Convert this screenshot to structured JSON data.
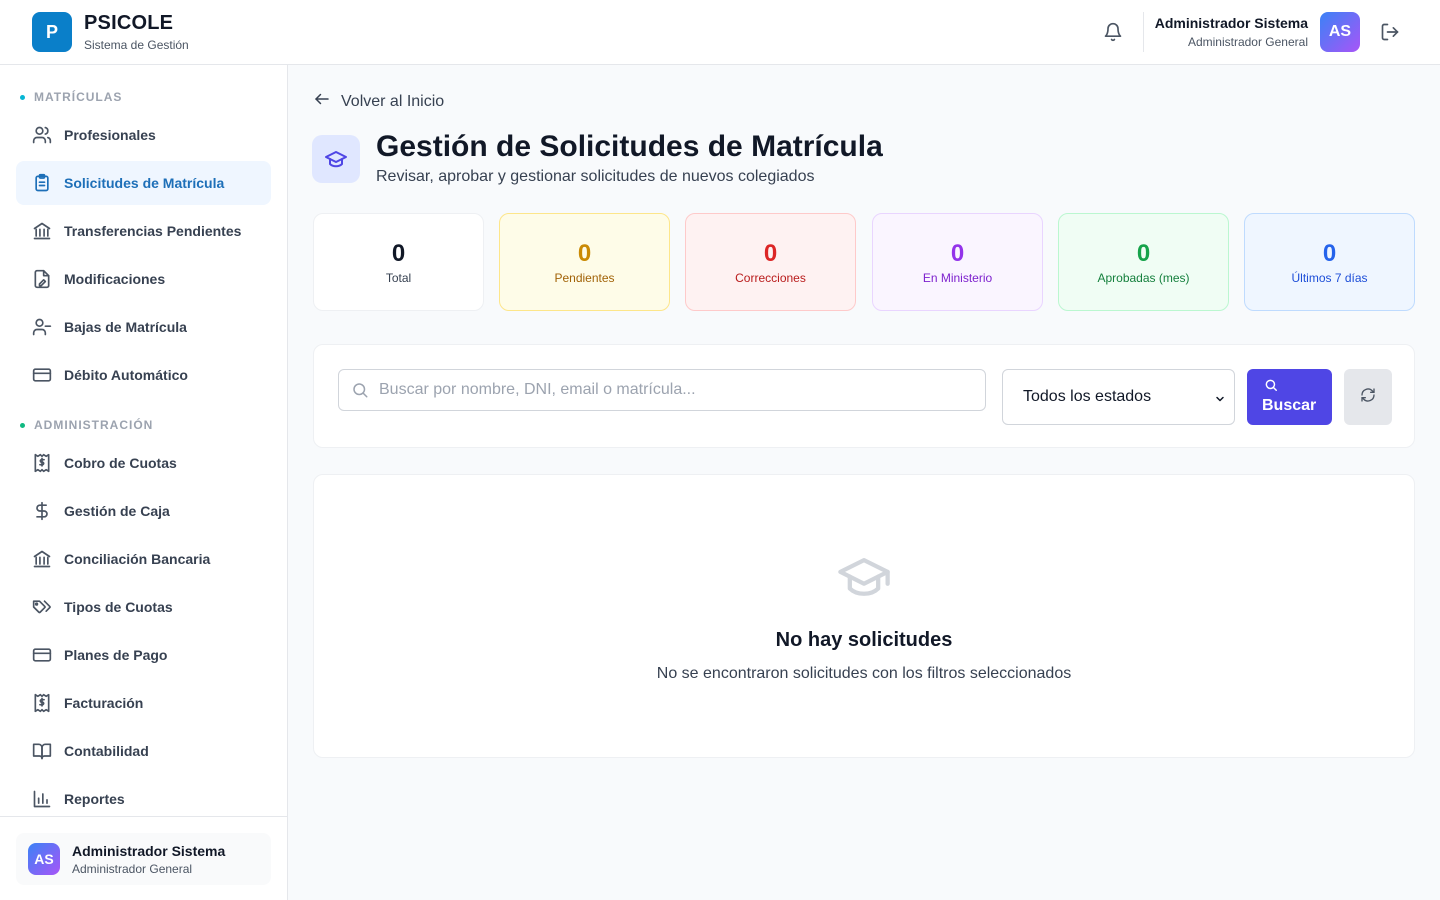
{
  "header": {
    "logo_letter": "P",
    "brand": "PSICOLE",
    "brand_sub": "Sistema de Gestión",
    "user_name": "Administrador Sistema",
    "user_role": "Administrador General",
    "avatar_initials": "AS",
    "icons": [
      "bell-icon",
      "logout-icon"
    ]
  },
  "sidebar": {
    "sections": [
      {
        "label": "MATRÍCULAS",
        "dot_color": "#06b6d4",
        "items": [
          {
            "label": "Profesionales",
            "icon": "users-icon"
          },
          {
            "label": "Solicitudes de Matrícula",
            "icon": "clipboard-list-icon",
            "active": true
          },
          {
            "label": "Transferencias Pendientes",
            "icon": "bank-icon"
          },
          {
            "label": "Modificaciones",
            "icon": "file-edit-icon"
          },
          {
            "label": "Bajas de Matrícula",
            "icon": "user-minus-icon"
          },
          {
            "label": "Débito Automático",
            "icon": "credit-card-icon"
          }
        ]
      },
      {
        "label": "ADMINISTRACIÓN",
        "dot_color": "#10b981",
        "items": [
          {
            "label": "Cobro de Cuotas",
            "icon": "receipt-dollar-icon"
          },
          {
            "label": "Gestión de Caja",
            "icon": "dollar-icon"
          },
          {
            "label": "Conciliación Bancaria",
            "icon": "bank-icon"
          },
          {
            "label": "Tipos de Cuotas",
            "icon": "tags-icon"
          },
          {
            "label": "Planes de Pago",
            "icon": "credit-card-icon"
          },
          {
            "label": "Facturación",
            "icon": "receipt-dollar-icon"
          },
          {
            "label": "Contabilidad",
            "icon": "book-open-icon"
          },
          {
            "label": "Reportes",
            "icon": "bar-chart-icon"
          }
        ]
      }
    ],
    "footer": {
      "avatar_initials": "AS",
      "name": "Administrador Sistema",
      "role": "Administrador General"
    }
  },
  "main": {
    "back_label": "Volver al Inicio",
    "title": "Gestión de Solicitudes de Matrícula",
    "subtitle": "Revisar, aprobar y gestionar solicitudes de nuevos colegiados",
    "stats": [
      {
        "value": "0",
        "label": "Total",
        "bg": "#ffffff",
        "border": "#eef0f3",
        "color": "#111827",
        "label_color": "#374151"
      },
      {
        "value": "0",
        "label": "Pendientes",
        "bg": "#fefce8",
        "border": "#fde68a",
        "color": "#ca8a04",
        "label_color": "#a16207"
      },
      {
        "value": "0",
        "label": "Correcciones",
        "bg": "#fef2f2",
        "border": "#fecaca",
        "color": "#dc2626",
        "label_color": "#b91c1c"
      },
      {
        "value": "0",
        "label": "En Ministerio",
        "bg": "#faf5ff",
        "border": "#e9d5ff",
        "color": "#9333ea",
        "label_color": "#7e22ce"
      },
      {
        "value": "0",
        "label": "Aprobadas (mes)",
        "bg": "#f0fdf4",
        "border": "#bbf7d0",
        "color": "#16a34a",
        "label_color": "#15803d"
      },
      {
        "value": "0",
        "label": "Últimos 7 días",
        "bg": "#eff6ff",
        "border": "#bfdbfe",
        "color": "#2563eb",
        "label_color": "#1d4ed8"
      }
    ],
    "search": {
      "placeholder": "Buscar por nombre, DNI, email o matrícula...",
      "value": ""
    },
    "status_filter": {
      "selected": "Todos los estados"
    },
    "search_button": "Buscar",
    "empty": {
      "title": "No hay solicitudes",
      "subtitle": "No se encontraron solicitudes con los filtros seleccionados"
    }
  }
}
